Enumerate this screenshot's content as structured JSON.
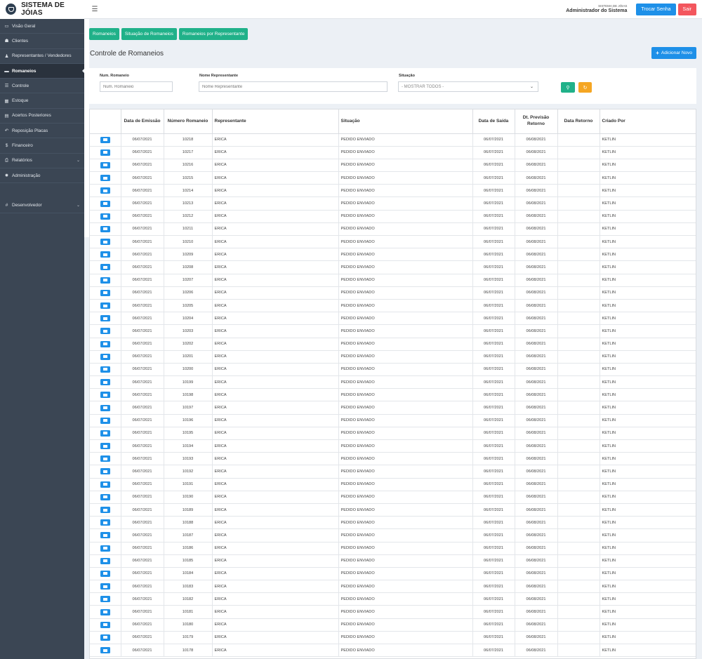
{
  "header": {
    "brand_title": "SISTEMA DE JÓIAS",
    "menu_icon": "bars-icon",
    "system_small": "SISTEMA DE JÓIAS",
    "user_name": "Administrador do Sistema",
    "change_password_label": "Trocar Senha",
    "logout_label": "Sair"
  },
  "sidebar": {
    "items": [
      {
        "icon": "▭",
        "label": "Visão Geral"
      },
      {
        "icon": "☗",
        "label": "Clientes"
      },
      {
        "icon": "♟",
        "label": "Representantes / Vendedores"
      },
      {
        "icon": "▬",
        "label": "Romaneios"
      },
      {
        "icon": "☰",
        "label": "Controle"
      },
      {
        "icon": "▦",
        "label": "Estoque"
      },
      {
        "icon": "▤",
        "label": "Acertos Posteriores"
      },
      {
        "icon": "↶",
        "label": "Reposição Placas"
      },
      {
        "icon": "$",
        "label": "Financeiro"
      },
      {
        "icon": "⎙",
        "label": "Relatórios"
      },
      {
        "icon": "✹",
        "label": "Administração"
      },
      {
        "icon": "#",
        "label": "Desenvolvedor"
      }
    ]
  },
  "tabs": [
    "Romaneios",
    "Situação de Romaneios",
    "Romaneios por Representante"
  ],
  "page_title": "Controle de Romaneios",
  "add_button_label": "Adicionar Novo",
  "filters": {
    "num_label": "Num. Romaneio",
    "num_placeholder": "Num. Romaneio",
    "rep_label": "Nome Representante",
    "rep_placeholder": "Nome Representante",
    "status_label": "Situação",
    "status_selected": "- MOSTRAR TODOS -"
  },
  "table": {
    "headers": {
      "emission": "Data de Emissão",
      "number": "Número Romaneio",
      "rep": "Representante",
      "status": "Situação",
      "out": "Data de Saída",
      "forecast": "Dt. Previsão Retorno",
      "ret": "Data Retorno",
      "created": "Criado Por"
    },
    "rows": [
      {
        "emission": "06/07/2021",
        "number": "10218",
        "rep": "ERICA",
        "status": "PEDIDO ENVIADO",
        "out": "06/07/2021",
        "forecast": "06/08/2021",
        "ret": "",
        "created": "KETLIN"
      },
      {
        "emission": "06/07/2021",
        "number": "10217",
        "rep": "ERICA",
        "status": "PEDIDO ENVIADO",
        "out": "06/07/2021",
        "forecast": "06/08/2021",
        "ret": "",
        "created": "KETLIN"
      },
      {
        "emission": "06/07/2021",
        "number": "10216",
        "rep": "ERICA",
        "status": "PEDIDO ENVIADO",
        "out": "06/07/2021",
        "forecast": "06/08/2021",
        "ret": "",
        "created": "KETLIN"
      },
      {
        "emission": "06/07/2021",
        "number": "10215",
        "rep": "ERICA",
        "status": "PEDIDO ENVIADO",
        "out": "06/07/2021",
        "forecast": "06/08/2021",
        "ret": "",
        "created": "KETLIN"
      },
      {
        "emission": "06/07/2021",
        "number": "10214",
        "rep": "ERICA",
        "status": "PEDIDO ENVIADO",
        "out": "06/07/2021",
        "forecast": "06/08/2021",
        "ret": "",
        "created": "KETLIN"
      },
      {
        "emission": "06/07/2021",
        "number": "10213",
        "rep": "ERICA",
        "status": "PEDIDO ENVIADO",
        "out": "06/07/2021",
        "forecast": "06/08/2021",
        "ret": "",
        "created": "KETLIN"
      },
      {
        "emission": "06/07/2021",
        "number": "10212",
        "rep": "ERICA",
        "status": "PEDIDO ENVIADO",
        "out": "06/07/2021",
        "forecast": "06/08/2021",
        "ret": "",
        "created": "KETLIN"
      },
      {
        "emission": "06/07/2021",
        "number": "10211",
        "rep": "ERICA",
        "status": "PEDIDO ENVIADO",
        "out": "06/07/2021",
        "forecast": "06/08/2021",
        "ret": "",
        "created": "KETLIN"
      },
      {
        "emission": "06/07/2021",
        "number": "10210",
        "rep": "ERICA",
        "status": "PEDIDO ENVIADO",
        "out": "06/07/2021",
        "forecast": "06/08/2021",
        "ret": "",
        "created": "KETLIN"
      },
      {
        "emission": "06/07/2021",
        "number": "10209",
        "rep": "ERICA",
        "status": "PEDIDO ENVIADO",
        "out": "06/07/2021",
        "forecast": "06/08/2021",
        "ret": "",
        "created": "KETLIN"
      },
      {
        "emission": "06/07/2021",
        "number": "10208",
        "rep": "ERICA",
        "status": "PEDIDO ENVIADO",
        "out": "06/07/2021",
        "forecast": "06/08/2021",
        "ret": "",
        "created": "KETLIN"
      },
      {
        "emission": "06/07/2021",
        "number": "10207",
        "rep": "ERICA",
        "status": "PEDIDO ENVIADO",
        "out": "06/07/2021",
        "forecast": "06/08/2021",
        "ret": "",
        "created": "KETLIN"
      },
      {
        "emission": "06/07/2021",
        "number": "10206",
        "rep": "ERICA",
        "status": "PEDIDO ENVIADO",
        "out": "06/07/2021",
        "forecast": "06/08/2021",
        "ret": "",
        "created": "KETLIN"
      },
      {
        "emission": "06/07/2021",
        "number": "10205",
        "rep": "ERICA",
        "status": "PEDIDO ENVIADO",
        "out": "06/07/2021",
        "forecast": "06/08/2021",
        "ret": "",
        "created": "KETLIN"
      },
      {
        "emission": "06/07/2021",
        "number": "10204",
        "rep": "ERICA",
        "status": "PEDIDO ENVIADO",
        "out": "06/07/2021",
        "forecast": "06/08/2021",
        "ret": "",
        "created": "KETLIN"
      },
      {
        "emission": "06/07/2021",
        "number": "10203",
        "rep": "ERICA",
        "status": "PEDIDO ENVIADO",
        "out": "06/07/2021",
        "forecast": "06/08/2021",
        "ret": "",
        "created": "KETLIN"
      },
      {
        "emission": "06/07/2021",
        "number": "10202",
        "rep": "ERICA",
        "status": "PEDIDO ENVIADO",
        "out": "06/07/2021",
        "forecast": "06/08/2021",
        "ret": "",
        "created": "KETLIN"
      },
      {
        "emission": "06/07/2021",
        "number": "10201",
        "rep": "ERICA",
        "status": "PEDIDO ENVIADO",
        "out": "06/07/2021",
        "forecast": "06/08/2021",
        "ret": "",
        "created": "KETLIN"
      },
      {
        "emission": "06/07/2021",
        "number": "10200",
        "rep": "ERICA",
        "status": "PEDIDO ENVIADO",
        "out": "06/07/2021",
        "forecast": "06/08/2021",
        "ret": "",
        "created": "KETLIN"
      },
      {
        "emission": "06/07/2021",
        "number": "10199",
        "rep": "ERICA",
        "status": "PEDIDO ENVIADO",
        "out": "06/07/2021",
        "forecast": "06/08/2021",
        "ret": "",
        "created": "KETLIN"
      },
      {
        "emission": "06/07/2021",
        "number": "10198",
        "rep": "ERICA",
        "status": "PEDIDO ENVIADO",
        "out": "06/07/2021",
        "forecast": "06/08/2021",
        "ret": "",
        "created": "KETLIN"
      },
      {
        "emission": "06/07/2021",
        "number": "10197",
        "rep": "ERICA",
        "status": "PEDIDO ENVIADO",
        "out": "06/07/2021",
        "forecast": "06/08/2021",
        "ret": "",
        "created": "KETLIN"
      },
      {
        "emission": "06/07/2021",
        "number": "10196",
        "rep": "ERICA",
        "status": "PEDIDO ENVIADO",
        "out": "06/07/2021",
        "forecast": "06/08/2021",
        "ret": "",
        "created": "KETLIN"
      },
      {
        "emission": "06/07/2021",
        "number": "10195",
        "rep": "ERICA",
        "status": "PEDIDO ENVIADO",
        "out": "06/07/2021",
        "forecast": "06/08/2021",
        "ret": "",
        "created": "KETLIN"
      },
      {
        "emission": "06/07/2021",
        "number": "10194",
        "rep": "ERICA",
        "status": "PEDIDO ENVIADO",
        "out": "06/07/2021",
        "forecast": "06/08/2021",
        "ret": "",
        "created": "KETLIN"
      },
      {
        "emission": "06/07/2021",
        "number": "10193",
        "rep": "ERICA",
        "status": "PEDIDO ENVIADO",
        "out": "06/07/2021",
        "forecast": "06/08/2021",
        "ret": "",
        "created": "KETLIN"
      },
      {
        "emission": "06/07/2021",
        "number": "10192",
        "rep": "ERICA",
        "status": "PEDIDO ENVIADO",
        "out": "06/07/2021",
        "forecast": "06/08/2021",
        "ret": "",
        "created": "KETLIN"
      },
      {
        "emission": "06/07/2021",
        "number": "10191",
        "rep": "ERICA",
        "status": "PEDIDO ENVIADO",
        "out": "06/07/2021",
        "forecast": "06/08/2021",
        "ret": "",
        "created": "KETLIN"
      },
      {
        "emission": "06/07/2021",
        "number": "10190",
        "rep": "ERICA",
        "status": "PEDIDO ENVIADO",
        "out": "06/07/2021",
        "forecast": "06/08/2021",
        "ret": "",
        "created": "KETLIN"
      },
      {
        "emission": "06/07/2021",
        "number": "10189",
        "rep": "ERICA",
        "status": "PEDIDO ENVIADO",
        "out": "06/07/2021",
        "forecast": "06/08/2021",
        "ret": "",
        "created": "KETLIN"
      },
      {
        "emission": "06/07/2021",
        "number": "10188",
        "rep": "ERICA",
        "status": "PEDIDO ENVIADO",
        "out": "06/07/2021",
        "forecast": "06/08/2021",
        "ret": "",
        "created": "KETLIN"
      },
      {
        "emission": "06/07/2021",
        "number": "10187",
        "rep": "ERICA",
        "status": "PEDIDO ENVIADO",
        "out": "06/07/2021",
        "forecast": "06/08/2021",
        "ret": "",
        "created": "KETLIN"
      },
      {
        "emission": "06/07/2021",
        "number": "10186",
        "rep": "ERICA",
        "status": "PEDIDO ENVIADO",
        "out": "06/07/2021",
        "forecast": "06/08/2021",
        "ret": "",
        "created": "KETLIN"
      },
      {
        "emission": "06/07/2021",
        "number": "10185",
        "rep": "ERICA",
        "status": "PEDIDO ENVIADO",
        "out": "06/07/2021",
        "forecast": "06/08/2021",
        "ret": "",
        "created": "KETLIN"
      },
      {
        "emission": "06/07/2021",
        "number": "10184",
        "rep": "ERICA",
        "status": "PEDIDO ENVIADO",
        "out": "06/07/2021",
        "forecast": "06/08/2021",
        "ret": "",
        "created": "KETLIN"
      },
      {
        "emission": "06/07/2021",
        "number": "10183",
        "rep": "ERICA",
        "status": "PEDIDO ENVIADO",
        "out": "06/07/2021",
        "forecast": "06/08/2021",
        "ret": "",
        "created": "KETLIN"
      },
      {
        "emission": "06/07/2021",
        "number": "10182",
        "rep": "ERICA",
        "status": "PEDIDO ENVIADO",
        "out": "06/07/2021",
        "forecast": "06/08/2021",
        "ret": "",
        "created": "KETLIN"
      },
      {
        "emission": "06/07/2021",
        "number": "10181",
        "rep": "ERICA",
        "status": "PEDIDO ENVIADO",
        "out": "06/07/2021",
        "forecast": "06/08/2021",
        "ret": "",
        "created": "KETLIN"
      },
      {
        "emission": "06/07/2021",
        "number": "10180",
        "rep": "ERICA",
        "status": "PEDIDO ENVIADO",
        "out": "06/07/2021",
        "forecast": "06/08/2021",
        "ret": "",
        "created": "KETLIN"
      },
      {
        "emission": "06/07/2021",
        "number": "10179",
        "rep": "ERICA",
        "status": "PEDIDO ENVIADO",
        "out": "06/07/2021",
        "forecast": "06/08/2021",
        "ret": "",
        "created": "KETLIN"
      },
      {
        "emission": "06/07/2021",
        "number": "10178",
        "rep": "ERICA",
        "status": "PEDIDO ENVIADO",
        "out": "06/07/2021",
        "forecast": "06/08/2021",
        "ret": "",
        "created": "KETLIN"
      }
    ]
  }
}
